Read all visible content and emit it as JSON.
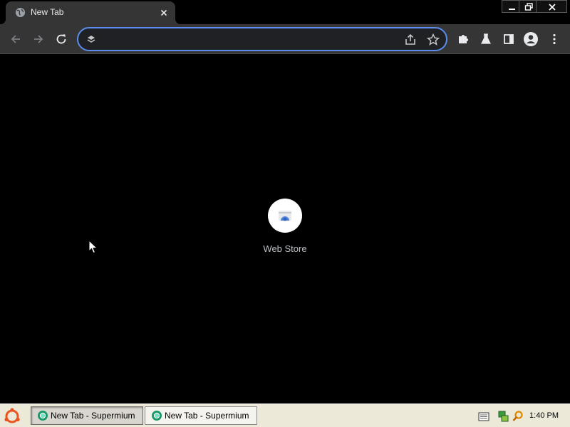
{
  "browser": {
    "tab": {
      "title": "New Tab"
    },
    "omnibox": {
      "value": "",
      "placeholder": ""
    }
  },
  "new_tab_page": {
    "shortcuts": [
      {
        "label": "Web Store"
      }
    ]
  },
  "taskbar": {
    "buttons": [
      {
        "label": "New Tab - Supermium",
        "active": true
      },
      {
        "label": "New Tab - Supermium",
        "active": false
      }
    ],
    "clock": "1:40 PM"
  },
  "colors": {
    "page_background": "#000000",
    "toolbar": "#353535",
    "omnibox_focus_ring": "#5b8def",
    "taskbar": "#ece9d8"
  },
  "icons": {
    "tab_favicon": "globe-icon",
    "tab_close": "close-icon",
    "back": "back-arrow-icon",
    "forward": "forward-arrow-icon",
    "reload": "reload-icon",
    "share": "share-icon",
    "bookmark": "star-icon",
    "extensions": "puzzle-icon",
    "labs": "flask-icon",
    "side_panel": "side-panel-icon",
    "profile": "profile-icon",
    "menu": "kebab-menu-icon"
  }
}
